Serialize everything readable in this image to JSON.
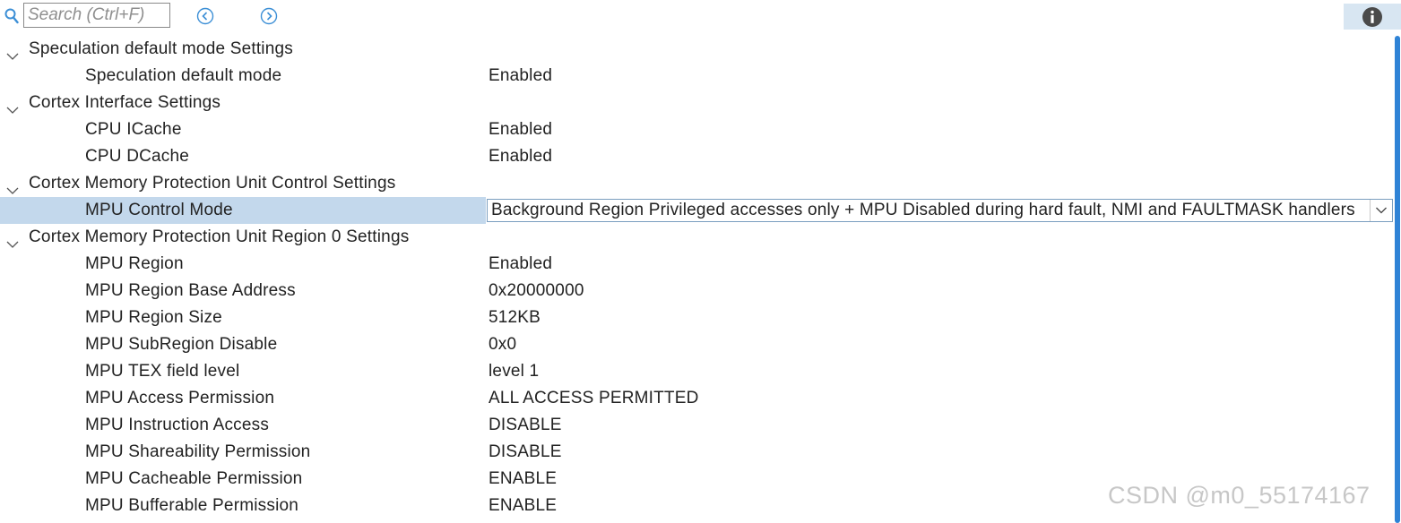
{
  "toolbar": {
    "search_placeholder": "Search (Ctrl+F)",
    "search_value": "",
    "icons": {
      "search": "search-icon",
      "prev": "chevron-left-circle-icon",
      "next": "chevron-right-circle-icon",
      "info": "info-icon"
    },
    "accent_color": "#3c8fd6"
  },
  "groups": [
    {
      "label": "Speculation default mode Settings",
      "expanded": true,
      "properties": [
        {
          "label": "Speculation default mode",
          "value": "Enabled"
        }
      ]
    },
    {
      "label": "Cortex Interface Settings",
      "expanded": true,
      "properties": [
        {
          "label": "CPU ICache",
          "value": "Enabled"
        },
        {
          "label": "CPU DCache",
          "value": "Enabled"
        }
      ]
    },
    {
      "label": "Cortex Memory Protection Unit Control Settings",
      "expanded": true,
      "properties": [
        {
          "label": "MPU Control Mode",
          "value": "Background Region Privileged accesses only + MPU Disabled during hard fault, NMI and FAULTMASK handlers",
          "selected": true,
          "editor": "dropdown"
        }
      ]
    },
    {
      "label": "Cortex Memory Protection Unit Region 0 Settings",
      "expanded": true,
      "properties": [
        {
          "label": "MPU Region",
          "value": "Enabled"
        },
        {
          "label": "MPU Region Base Address",
          "value": "0x20000000"
        },
        {
          "label": "MPU Region Size",
          "value": "512KB"
        },
        {
          "label": "MPU SubRegion Disable",
          "value": "0x0"
        },
        {
          "label": "MPU TEX field level",
          "value": "level 1"
        },
        {
          "label": "MPU Access Permission",
          "value": "ALL ACCESS PERMITTED"
        },
        {
          "label": "MPU Instruction Access",
          "value": "DISABLE"
        },
        {
          "label": "MPU Shareability Permission",
          "value": "DISABLE"
        },
        {
          "label": "MPU Cacheable Permission",
          "value": "ENABLE"
        },
        {
          "label": "MPU Bufferable  Permission",
          "value": "ENABLE"
        }
      ]
    }
  ],
  "selection_color": "#c3d8ec",
  "scrollbar_color": "#2f83d6",
  "watermark": "CSDN @m0_55174167"
}
